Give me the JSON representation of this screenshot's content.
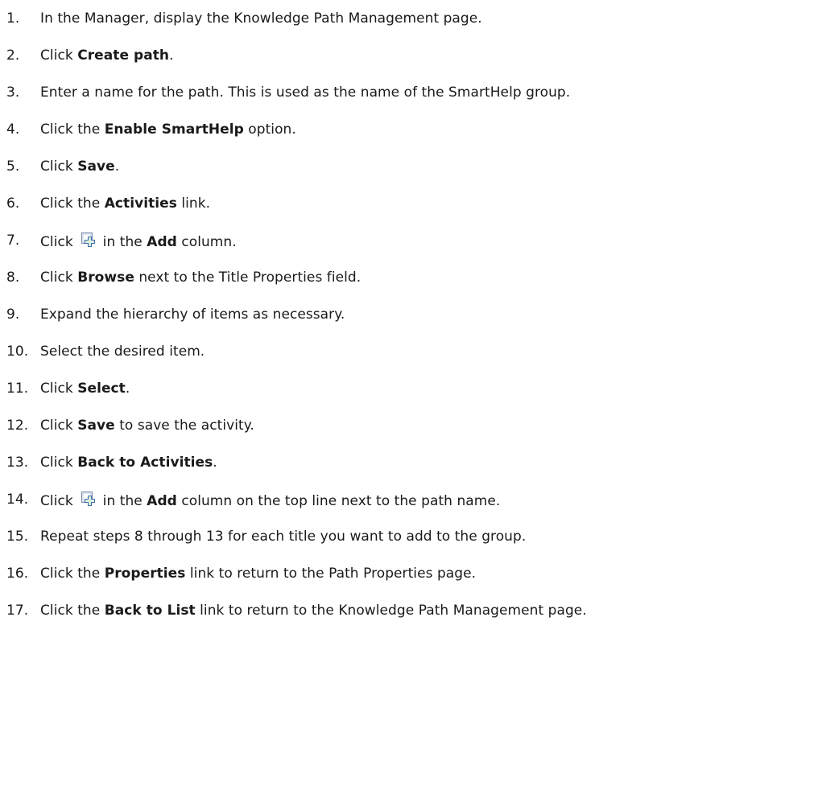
{
  "steps": [
    {
      "num": "1.",
      "parts": [
        {
          "t": "In the Manager, display the Knowledge Path Management page."
        }
      ]
    },
    {
      "num": "2.",
      "parts": [
        {
          "t": "Click "
        },
        {
          "t": "Create path",
          "b": true
        },
        {
          "t": "."
        }
      ]
    },
    {
      "num": "3.",
      "parts": [
        {
          "t": "Enter a name for the path. This is used as the name of the SmartHelp group."
        }
      ]
    },
    {
      "num": "4.",
      "parts": [
        {
          "t": "Click the "
        },
        {
          "t": "Enable SmartHelp",
          "b": true
        },
        {
          "t": " option."
        }
      ]
    },
    {
      "num": "5.",
      "parts": [
        {
          "t": "Click "
        },
        {
          "t": "Save",
          "b": true
        },
        {
          "t": "."
        }
      ]
    },
    {
      "num": "6.",
      "parts": [
        {
          "t": "Click the "
        },
        {
          "t": "Activities",
          "b": true
        },
        {
          "t": " link."
        }
      ]
    },
    {
      "num": "7.",
      "parts": [
        {
          "t": "Click "
        },
        {
          "icon": "add-activity-icon"
        },
        {
          "t": " in the "
        },
        {
          "t": "Add",
          "b": true
        },
        {
          "t": " column."
        }
      ]
    },
    {
      "num": "8.",
      "parts": [
        {
          "t": "Click "
        },
        {
          "t": "Browse",
          "b": true
        },
        {
          "t": " next to the Title Properties field."
        }
      ]
    },
    {
      "num": "9.",
      "parts": [
        {
          "t": "Expand the hierarchy of items as necessary."
        }
      ]
    },
    {
      "num": "10.",
      "parts": [
        {
          "t": "Select the desired item."
        }
      ]
    },
    {
      "num": "11.",
      "parts": [
        {
          "t": "Click "
        },
        {
          "t": "Select",
          "b": true
        },
        {
          "t": "."
        }
      ]
    },
    {
      "num": "12.",
      "parts": [
        {
          "t": "Click "
        },
        {
          "t": "Save",
          "b": true
        },
        {
          "t": " to save the activity."
        }
      ]
    },
    {
      "num": "13.",
      "parts": [
        {
          "t": "Click "
        },
        {
          "t": "Back to Activities",
          "b": true
        },
        {
          "t": "."
        }
      ]
    },
    {
      "num": "14.",
      "parts": [
        {
          "t": "Click "
        },
        {
          "icon": "add-activity-icon"
        },
        {
          "t": " in the "
        },
        {
          "t": "Add",
          "b": true
        },
        {
          "t": " column on the top line  next to the path name."
        }
      ]
    },
    {
      "num": "15.",
      "parts": [
        {
          "t": "Repeat steps 8 through 13 for each title you want to add to the group."
        }
      ]
    },
    {
      "num": "16.",
      "parts": [
        {
          "t": "Click the "
        },
        {
          "t": "Properties",
          "b": true
        },
        {
          "t": " link to return to the Path Properties page."
        }
      ]
    },
    {
      "num": "17.",
      "parts": [
        {
          "t": "Click the "
        },
        {
          "t": "Back to List",
          "b": true
        },
        {
          "t": " link to return to the Knowledge Path Management page."
        }
      ]
    }
  ]
}
